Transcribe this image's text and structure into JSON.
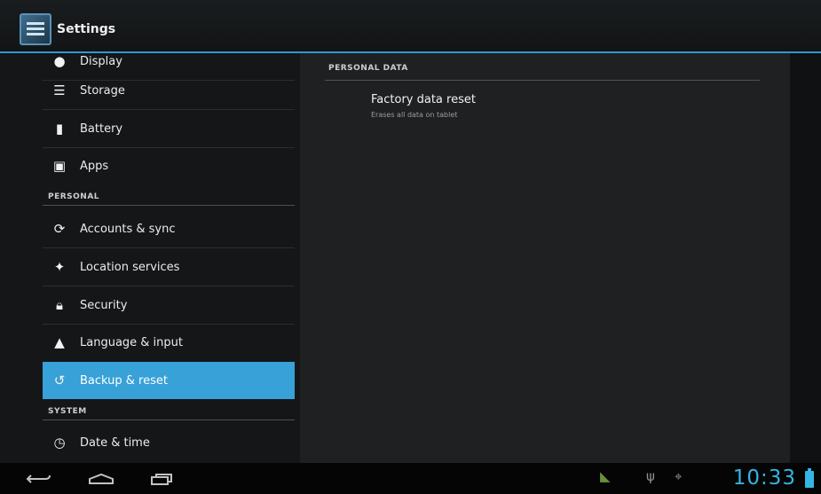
{
  "action_bar": {
    "title": "Settings"
  },
  "left_pane": {
    "items": [
      {
        "label": "Display",
        "icon": "display-icon"
      },
      {
        "label": "Storage",
        "icon": "storage-icon"
      },
      {
        "label": "Battery",
        "icon": "battery-icon"
      },
      {
        "label": "Apps",
        "icon": "apps-icon"
      },
      {
        "label": "Accounts & sync",
        "icon": "sync-icon"
      },
      {
        "label": "Location services",
        "icon": "location-icon"
      },
      {
        "label": "Security",
        "icon": "lock-icon"
      },
      {
        "label": "Language & input",
        "icon": "language-icon"
      },
      {
        "label": "Backup & reset",
        "icon": "backup-icon",
        "selected": true
      },
      {
        "label": "Date & time",
        "icon": "clock-icon"
      }
    ],
    "headers": {
      "personal": "PERSONAL",
      "system": "SYSTEM"
    }
  },
  "right_pane": {
    "section_header": "PERSONAL DATA",
    "pref_title": "Factory data reset",
    "pref_summary": "Erases all data on tablet"
  },
  "system_bar": {
    "time": "10:33",
    "nav": [
      "back-icon",
      "home-icon",
      "recent-apps-icon"
    ],
    "status_icons": [
      "android-debug-icon",
      "usb-icon",
      "usb-connection-icon"
    ],
    "accent_color": "#33b5e5"
  }
}
